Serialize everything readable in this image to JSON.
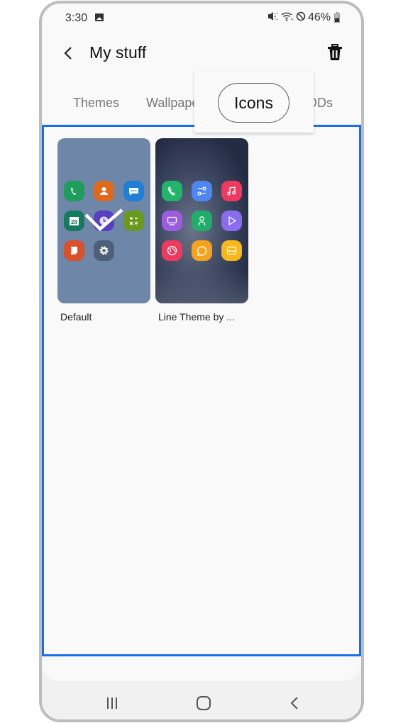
{
  "status_bar": {
    "time": "3:30",
    "battery_percent": "46%",
    "icons": [
      "gallery-notification-icon",
      "mute-icon",
      "wifi-icon",
      "do-not-disturb-icon",
      "battery-icon"
    ]
  },
  "app_bar": {
    "title": "My stuff",
    "back_icon": "chevron-left-icon",
    "delete_icon": "trash-icon"
  },
  "tabs": [
    {
      "label": "Themes",
      "selected": false
    },
    {
      "label": "Wallpapers",
      "selected": false
    },
    {
      "label": "Icons",
      "selected": true
    },
    {
      "label": "AODs",
      "selected": false
    }
  ],
  "callout": {
    "label": "Icons"
  },
  "items": [
    {
      "label": "Default",
      "applied": true,
      "background": "#6e86a8",
      "icons": [
        {
          "name": "phone-icon",
          "color": "#1e9e5a"
        },
        {
          "name": "contacts-icon",
          "color": "#e06a1c"
        },
        {
          "name": "messages-icon",
          "color": "#1f7ed6"
        },
        {
          "name": "calendar-icon",
          "color": "#137a5e",
          "text": "28"
        },
        {
          "name": "clock-icon",
          "color": "#5a3fc0"
        },
        {
          "name": "calculator-icon",
          "color": "#6a9a1c"
        },
        {
          "name": "notes-icon",
          "color": "#d9502a"
        },
        {
          "name": "settings-icon",
          "color": "#4c6177"
        }
      ]
    },
    {
      "label": "Line Theme by ...",
      "applied": false,
      "icons": [
        {
          "name": "phone-icon",
          "color": "#22b46a"
        },
        {
          "name": "connections-icon",
          "color": "#4f86f0"
        },
        {
          "name": "music-icon",
          "color": "#f0395e"
        },
        {
          "name": "tv-icon",
          "color": "#9b5de0"
        },
        {
          "name": "contacts-icon",
          "color": "#1fae6a"
        },
        {
          "name": "play-icon",
          "color": "#8a6cf0"
        },
        {
          "name": "internet-icon",
          "color": "#ef3a60"
        },
        {
          "name": "chat-icon",
          "color": "#f5a21c"
        },
        {
          "name": "gallery-icon",
          "color": "#f7b81c"
        }
      ]
    }
  ],
  "highlight_color": "#1a6cf0",
  "nav_bar": {
    "recents_icon": "recents-icon",
    "home_icon": "home-icon",
    "back_icon": "back-icon"
  }
}
